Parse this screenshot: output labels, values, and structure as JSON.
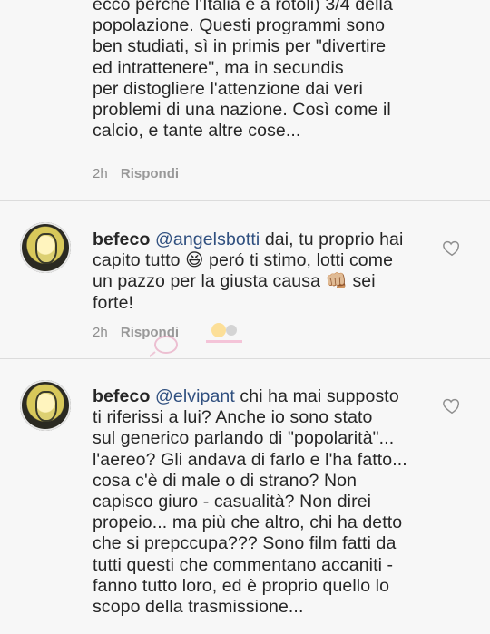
{
  "comments": [
    {
      "text": "ecco perchè l'Italia è a rotoli) 3/4 della\npopolazione. Questi programmi sono\nben studiati, sì in primis per \"divertire\ned intrattenere\", ma in secundis\nper distogliere l'attenzione dai veri\nproblemi di una nazione. Così come il\ncalcio, e tante altre cose...",
      "time": "2h",
      "reply": "Rispondi"
    },
    {
      "username": "befeco",
      "mention": "@angelsbotti",
      "text": " dai, tu proprio hai\ncapito tutto 😆 peró ti stimo, lotti come\nun pazzo per la giusta causa 👊🏼 sei\nforte!",
      "time": "2h",
      "reply": "Rispondi"
    },
    {
      "username": "befeco",
      "mention": "@elvipant",
      "text": " chi ha mai supposto\nti riferissi a lui? Anche io sono stato\nsul generico parlando di \"popolarità\"...\nl'aereo? Gli andava di farlo e l'ha fatto...\ncosa c'è di male o di strano? Non\ncapisco giuro - casualità? Non direi\npropeio... ma più che altro, chi ha detto\nche si prepccupa??? Sono film fatti da\ntutti questi che commentano accaniti -\nfanno tutto loro, ed è proprio quello lo\nscopo della trasmissione..."
    }
  ],
  "icons": {
    "like": "heart-outline-icon",
    "avatar": "avatar-image"
  },
  "colors": {
    "background": "#f7f7f7",
    "text": "#262626",
    "muted": "#8e8e8e",
    "mention": "#2f4f7f"
  }
}
